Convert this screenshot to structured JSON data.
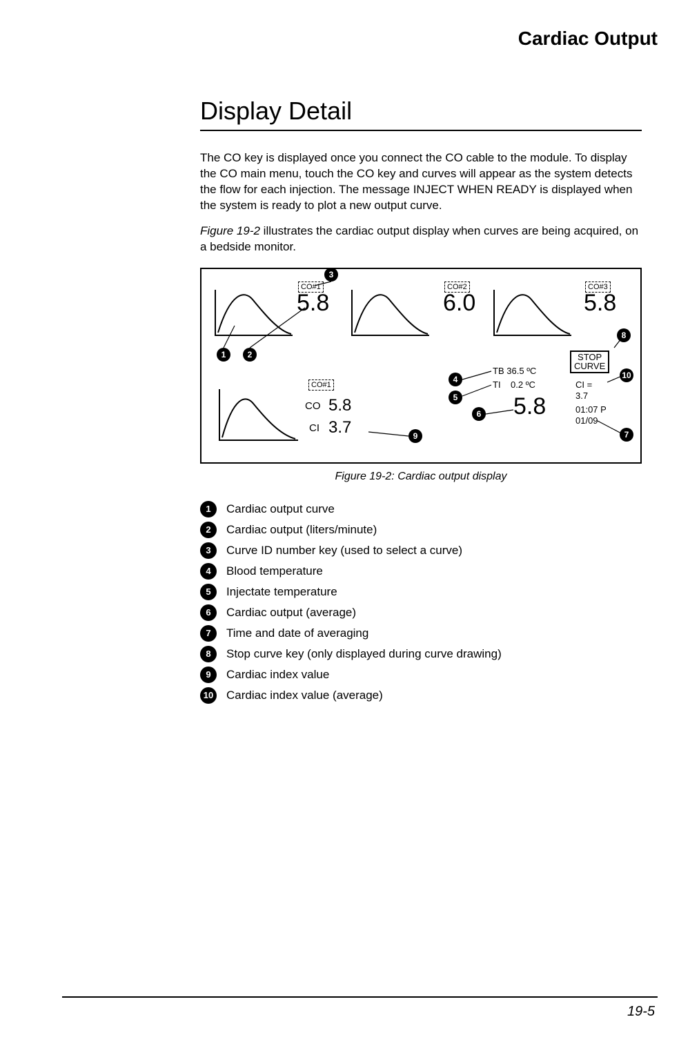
{
  "running_head": "Cardiac Output",
  "section_title": "Display Detail",
  "para1": "The CO key is displayed once you connect the CO cable to the module. To display the CO main menu, touch the CO key and curves will appear as the system detects the flow for each injection. The message INJECT WHEN READY is displayed when the system is ready to plot a new output curve.",
  "para2_lead": "Figure 19-2",
  "para2_rest": " illustrates the cardiac output display when curves are being acquired, on a bedside monitor.",
  "figure": {
    "curves": [
      {
        "key": "CO#1",
        "value": "5.8"
      },
      {
        "key": "CO#2",
        "value": "6.0"
      },
      {
        "key": "CO#3",
        "value": "5.8"
      }
    ],
    "detail_key": "CO#1",
    "detail_co_label": "CO",
    "detail_co_value": "5.8",
    "detail_ci_label": "CI",
    "detail_ci_value": "3.7",
    "tb_label": "TB",
    "tb_value": "36.5",
    "ti_label": "TI",
    "ti_value": "0.2",
    "deg_unit": "ºC",
    "avg_co": "5.8",
    "ci_eq_label": "CI =",
    "ci_eq_value": "3.7",
    "time": "01:07 P",
    "date": "01/09",
    "stop_key_l1": "STOP",
    "stop_key_l2": "CURVE"
  },
  "caption": "Figure 19-2: Cardiac output display",
  "legend": [
    "Cardiac output curve",
    "Cardiac output (liters/minute)",
    "Curve ID number key (used to select a curve)",
    "Blood temperature",
    "Injectate temperature",
    "Cardiac output (average)",
    "Time and date of averaging",
    "Stop curve key (only displayed during curve drawing)",
    "Cardiac index value",
    "Cardiac index value (average)"
  ],
  "page_number": "19-5",
  "callout_nums": [
    "1",
    "2",
    "3",
    "4",
    "5",
    "6",
    "7",
    "8",
    "9",
    "10"
  ]
}
